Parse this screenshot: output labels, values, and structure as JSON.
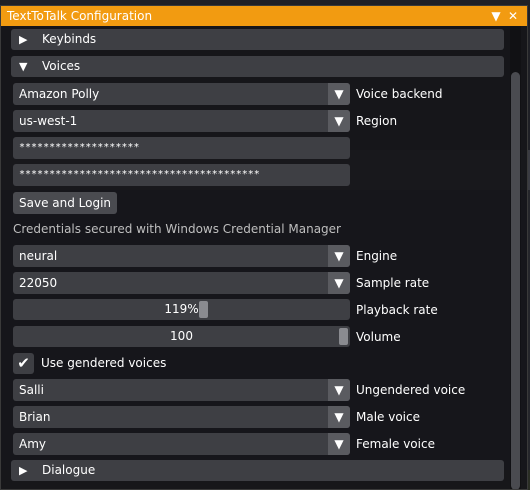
{
  "window": {
    "title": "TextToTalk Configuration",
    "collapse_icon": "triangle-down-icon",
    "close_icon": "close-icon"
  },
  "sections": {
    "keybinds": {
      "label": "Keybinds",
      "expanded": false
    },
    "voices": {
      "label": "Voices",
      "expanded": true
    },
    "dialogue": {
      "label": "Dialogue",
      "expanded": false
    }
  },
  "voices": {
    "backend": {
      "value": "Amazon Polly",
      "label": "Voice backend"
    },
    "region": {
      "value": "us-west-1",
      "label": "Region"
    },
    "access_key": "********************",
    "secret_key": "****************************************",
    "save_login_label": "Save and Login",
    "credentials_note": "Credentials secured with Windows Credential Manager",
    "engine": {
      "value": "neural",
      "label": "Engine"
    },
    "sample_rate": {
      "value": "22050",
      "label": "Sample rate"
    },
    "playback_rate": {
      "value": "119%",
      "label": "Playback rate",
      "level": 0.5667
    },
    "volume": {
      "value": "100",
      "label": "Volume",
      "level": 1.0
    },
    "gendered": {
      "label": "Use gendered voices",
      "checked": true
    },
    "ungendered_voice": {
      "value": "Salli",
      "label": "Ungendered voice"
    },
    "male_voice": {
      "value": "Brian",
      "label": "Male voice"
    },
    "female_voice": {
      "value": "Amy",
      "label": "Female voice"
    }
  },
  "colors": {
    "title_bar": "#f29b11",
    "widget_bg": "#3e3f44",
    "arrow_bg": "#5a5b60",
    "window_bg": "#16161a"
  }
}
